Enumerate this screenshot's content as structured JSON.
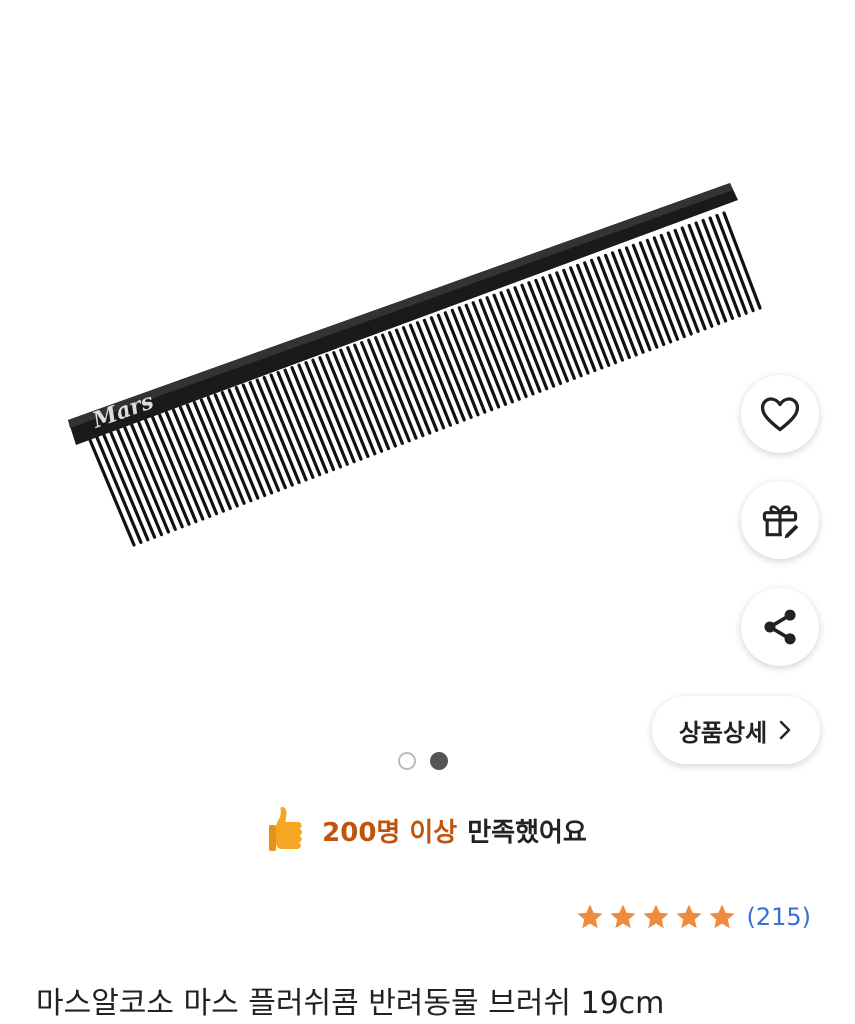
{
  "product": {
    "image_alt": "Mars comb",
    "brand_mark": "Mars",
    "title": "마스알코소 마스 플러쉬콤 반려동물 브러쉬 19cm"
  },
  "actions": {
    "wishlist_icon": "heart-icon",
    "gift_icon": "gift-icon",
    "share_icon": "share-icon",
    "detail_label": "상품상세",
    "detail_icon": "chevron-right-icon"
  },
  "carousel": {
    "total": 2,
    "active": 2
  },
  "satisfaction": {
    "icon": "thumbs-up-icon",
    "count_text": "200명 이상",
    "suffix_text": "만족했어요",
    "accent_color": "#c0540c"
  },
  "rating": {
    "stars": 5,
    "count_text": "(215)",
    "star_color": "#f08a3c"
  }
}
